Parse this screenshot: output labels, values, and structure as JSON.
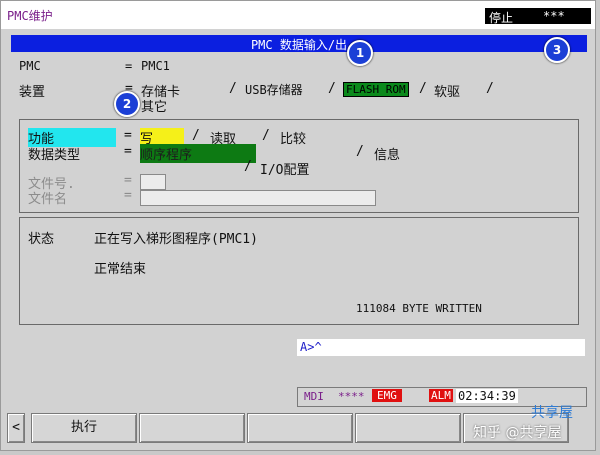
{
  "header": {
    "title": "PMC维护",
    "mode": "停止",
    "stars": "***"
  },
  "screen_title": "PMC 数据输入/出",
  "badges": [
    "1",
    "2",
    "3"
  ],
  "pmc": {
    "label": "PMC",
    "eq": "=",
    "value": "PMC1"
  },
  "device": {
    "label": "装置",
    "eq": "=",
    "options": [
      "存储卡",
      "/",
      "USB存储器",
      "/",
      "FLASH ROM",
      "/",
      "软驱",
      "/",
      "其它"
    ]
  },
  "function": {
    "label": "功能",
    "eq": "=",
    "write": "写",
    "sep1": "/",
    "read": "读取",
    "sep2": "/",
    "compare": "比较"
  },
  "data_type": {
    "label": "数据类型",
    "eq": "=",
    "ladder": "顺序程序",
    "sep1": "/",
    "info": "信息",
    "sep2": "/",
    "io": "I/O配置"
  },
  "file_no": {
    "label": "文件号.",
    "eq": "="
  },
  "file_name": {
    "label": "文件名",
    "eq": "="
  },
  "status": {
    "label": "状态",
    "line1": "正在写入梯形图程序(PMC1)",
    "line2": "正常结束",
    "bytes": "111084 BYTE WRITTEN"
  },
  "input_prompt": "A>^",
  "statusbar": {
    "mdi": "MDI",
    "stars": "****",
    "emg": "EMG",
    "alm": "ALM",
    "time": "02:34:39"
  },
  "softkeys": {
    "left_arrow": "<",
    "exec": "执行"
  },
  "watermark": {
    "site": "共享屋",
    "text": "知乎 @共享屋"
  },
  "colors": {
    "screen_bar": "#0b1fe0",
    "cyan": "#22e6ee",
    "yellow": "#f5f019",
    "green": "#0d7a13",
    "emg": "#e01010",
    "alm": "#e01010"
  }
}
